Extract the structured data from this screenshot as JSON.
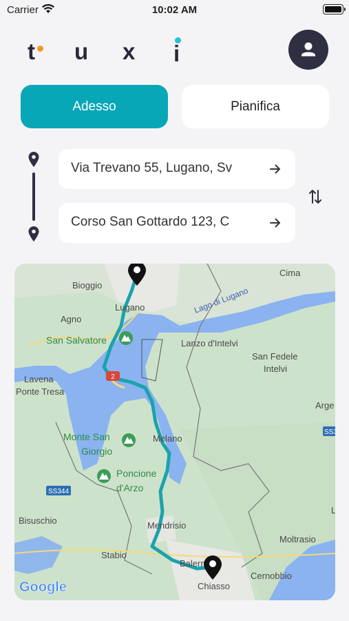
{
  "status_bar": {
    "carrier": "Carrier",
    "time": "10:02 AM"
  },
  "logo": {
    "letters": [
      "t",
      "u",
      "x",
      "i"
    ],
    "accent_colors": [
      "#f29a1f",
      "#27c3cf"
    ]
  },
  "mode_tabs": [
    {
      "label": "Adesso",
      "active": true
    },
    {
      "label": "Pianifica",
      "active": false
    }
  ],
  "route": {
    "origin": "Via Trevano 55, Lugano, Sv",
    "destination": "Corso San Gottardo 123, C"
  },
  "map": {
    "lake_label": "Lago di Lugano",
    "places": [
      "Cima",
      "Bioggio",
      "Lugano",
      "Agno",
      "San Salvatore",
      "Lanzo d'Intelvi",
      "San Fedele",
      "Intelvi",
      "Lavena",
      "Ponte Tresa",
      "Arge",
      "Monte San",
      "Giorgio",
      "Melano",
      "Poncione",
      "d'Arzo",
      "SS344",
      "SS3",
      "Bisuschio",
      "Mendrisio",
      "Moltrasio",
      "Stabio",
      "Balerna",
      "Chiasso",
      "Cernobbio",
      "L"
    ],
    "road_badge": "2",
    "attribution": "Google",
    "colors": {
      "water": "#8ab3f0",
      "land": "#cde2cb",
      "route": "#1aa3ad",
      "brand_teal": "#08a7b8",
      "dark": "#2f2f42"
    }
  }
}
